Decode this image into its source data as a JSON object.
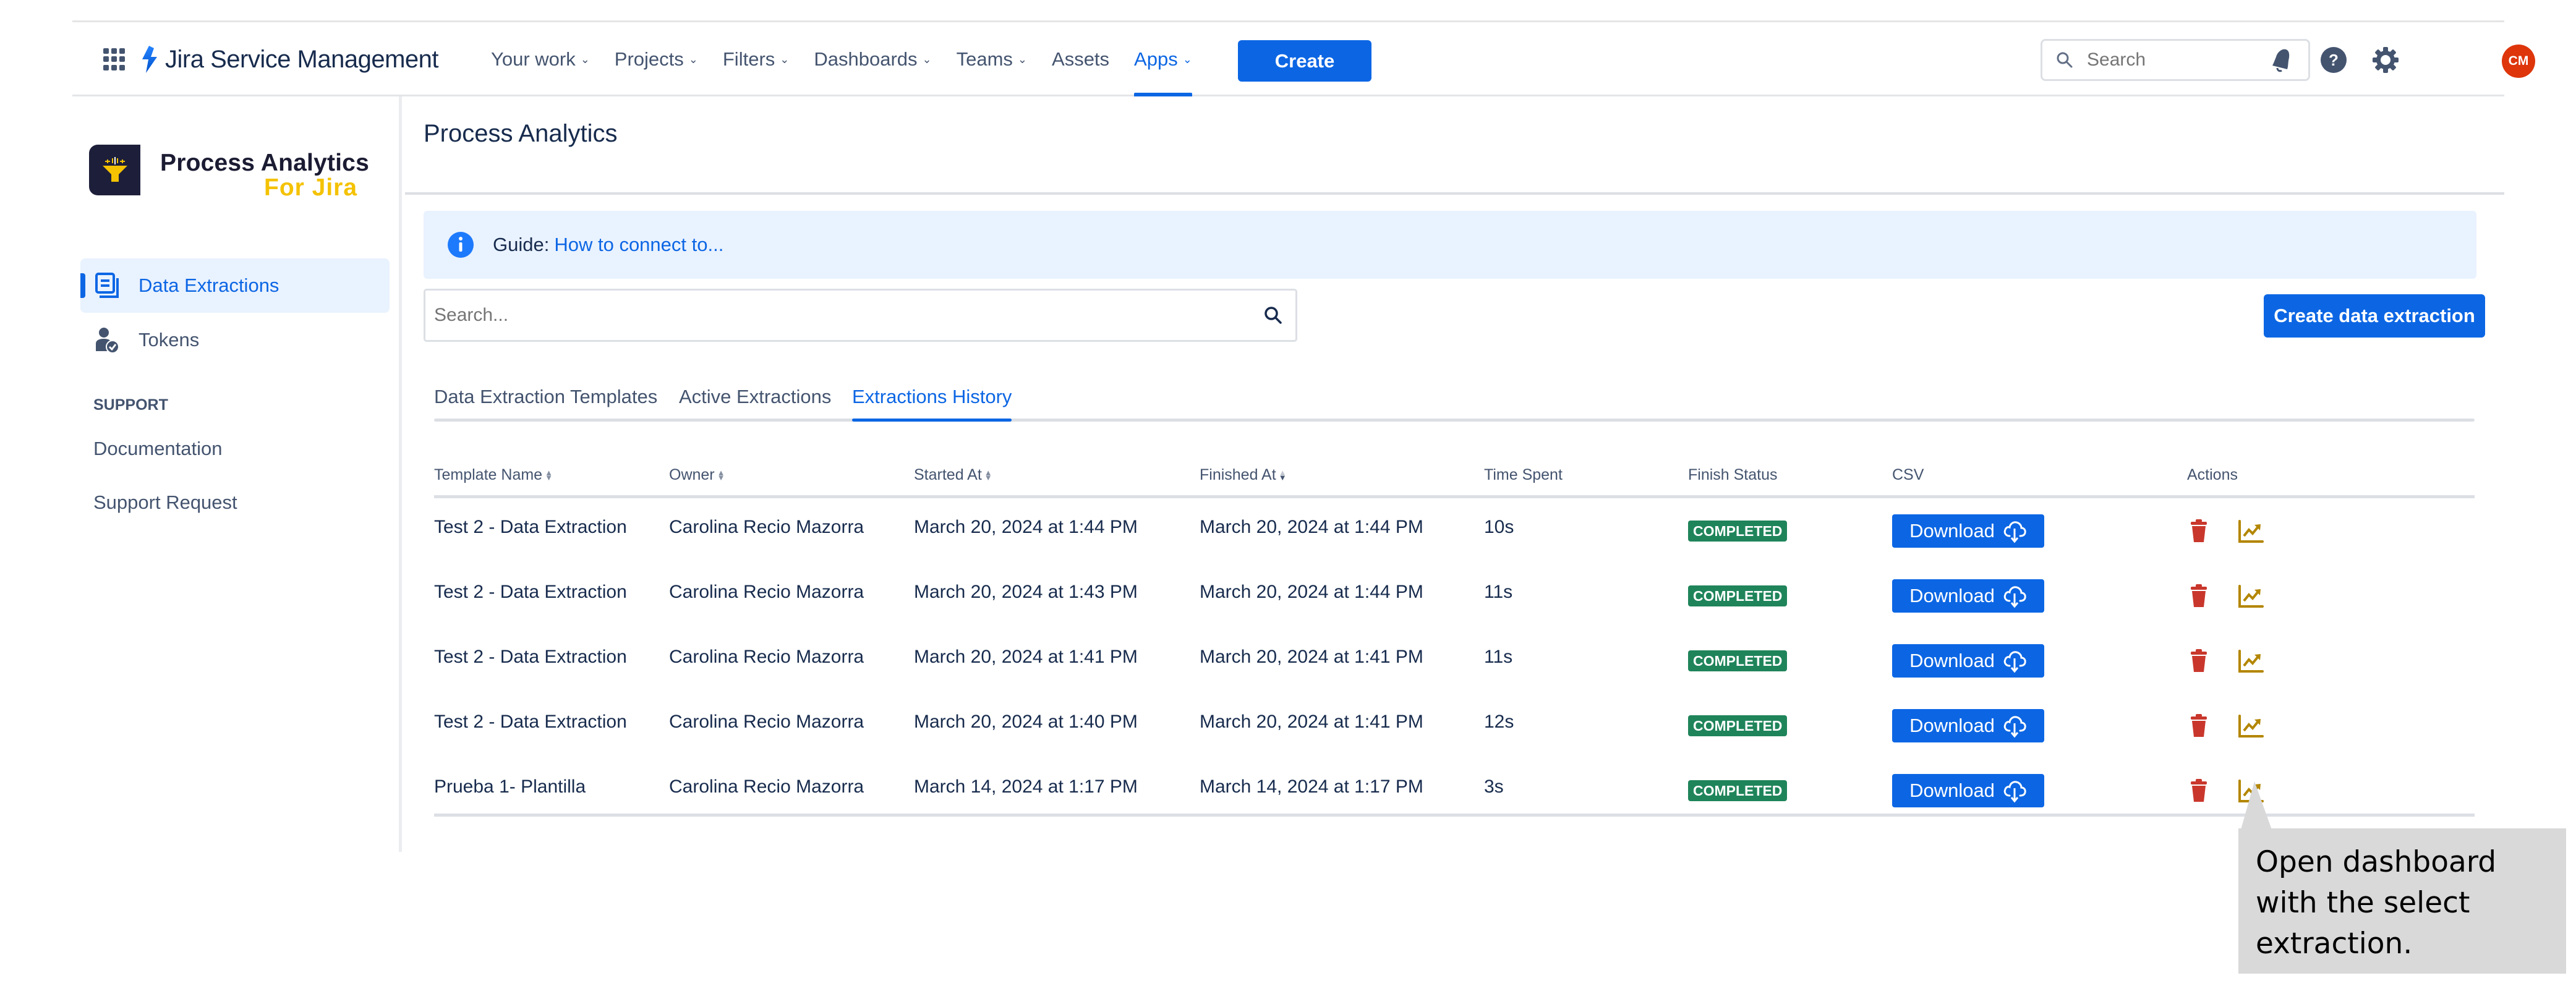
{
  "header": {
    "app_switcher_icon": "grid-icon",
    "product_name": "Jira Service Management",
    "nav": [
      {
        "label": "Your work",
        "dropdown": true
      },
      {
        "label": "Projects",
        "dropdown": true
      },
      {
        "label": "Filters",
        "dropdown": true
      },
      {
        "label": "Dashboards",
        "dropdown": true
      },
      {
        "label": "Teams",
        "dropdown": true
      },
      {
        "label": "Assets",
        "dropdown": false
      },
      {
        "label": "Apps",
        "dropdown": true,
        "active": true
      }
    ],
    "create_label": "Create",
    "search_placeholder": "Search",
    "icons": [
      "notifications-icon",
      "help-icon",
      "settings-icon"
    ],
    "avatar_initials": "CM"
  },
  "sidebar": {
    "app_title": "Process Analytics",
    "app_subtitle": "For Jira",
    "items": [
      {
        "label": "Data Extractions",
        "icon": "document-icon",
        "active": true
      },
      {
        "label": "Tokens",
        "icon": "user-check-icon",
        "active": false
      }
    ],
    "support_heading": "SUPPORT",
    "support_links": [
      "Documentation",
      "Support Request"
    ]
  },
  "main": {
    "page_title": "Process Analytics",
    "banner": {
      "prefix": "Guide:",
      "link": "How to connect to..."
    },
    "search_placeholder": "Search...",
    "create_button": "Create data extraction",
    "tabs": [
      {
        "label": "Data Extraction Templates",
        "active": false
      },
      {
        "label": "Active Extractions",
        "active": false
      },
      {
        "label": "Extractions History",
        "active": true
      }
    ],
    "table": {
      "columns": [
        {
          "label": "Template Name",
          "sortable": true
        },
        {
          "label": "Owner",
          "sortable": true
        },
        {
          "label": "Started At",
          "sortable": true
        },
        {
          "label": "Finished At",
          "sortable": true
        },
        {
          "label": "Time Spent",
          "sortable": false
        },
        {
          "label": "Finish Status",
          "sortable": false
        },
        {
          "label": "CSV",
          "sortable": false
        },
        {
          "label": "Actions",
          "sortable": false
        }
      ],
      "download_label": "Download",
      "rows": [
        {
          "template": "Test 2 - Data Extraction",
          "owner": "Carolina Recio Mazorra",
          "started": "March 20, 2024 at 1:44 PM",
          "finished": "March 20, 2024 at 1:44 PM",
          "time_spent": "10s",
          "status": "COMPLETED"
        },
        {
          "template": "Test 2 - Data Extraction",
          "owner": "Carolina Recio Mazorra",
          "started": "March 20, 2024 at 1:43 PM",
          "finished": "March 20, 2024 at 1:44 PM",
          "time_spent": "11s",
          "status": "COMPLETED"
        },
        {
          "template": "Test 2 - Data Extraction",
          "owner": "Carolina Recio Mazorra",
          "started": "March 20, 2024 at 1:41 PM",
          "finished": "March 20, 2024 at 1:41 PM",
          "time_spent": "11s",
          "status": "COMPLETED"
        },
        {
          "template": "Test 2 - Data Extraction",
          "owner": "Carolina Recio Mazorra",
          "started": "March 20, 2024 at 1:40 PM",
          "finished": "March 20, 2024 at 1:41 PM",
          "time_spent": "12s",
          "status": "COMPLETED"
        },
        {
          "template": "Prueba 1- Plantilla",
          "owner": "Carolina Recio Mazorra",
          "started": "March 14, 2024 at 1:17 PM",
          "finished": "March 14, 2024 at 1:17 PM",
          "time_spent": "3s",
          "status": "COMPLETED"
        }
      ]
    }
  },
  "callout": {
    "text": "Open dashboard with the select extraction."
  },
  "colors": {
    "primary": "#0c66e4",
    "success": "#1f845a",
    "delete": "#c9372c",
    "dashboard": "#b38600",
    "avatar": "#de350b",
    "banner_bg": "#e9f2ff",
    "brand_yellow": "#f4c200"
  }
}
